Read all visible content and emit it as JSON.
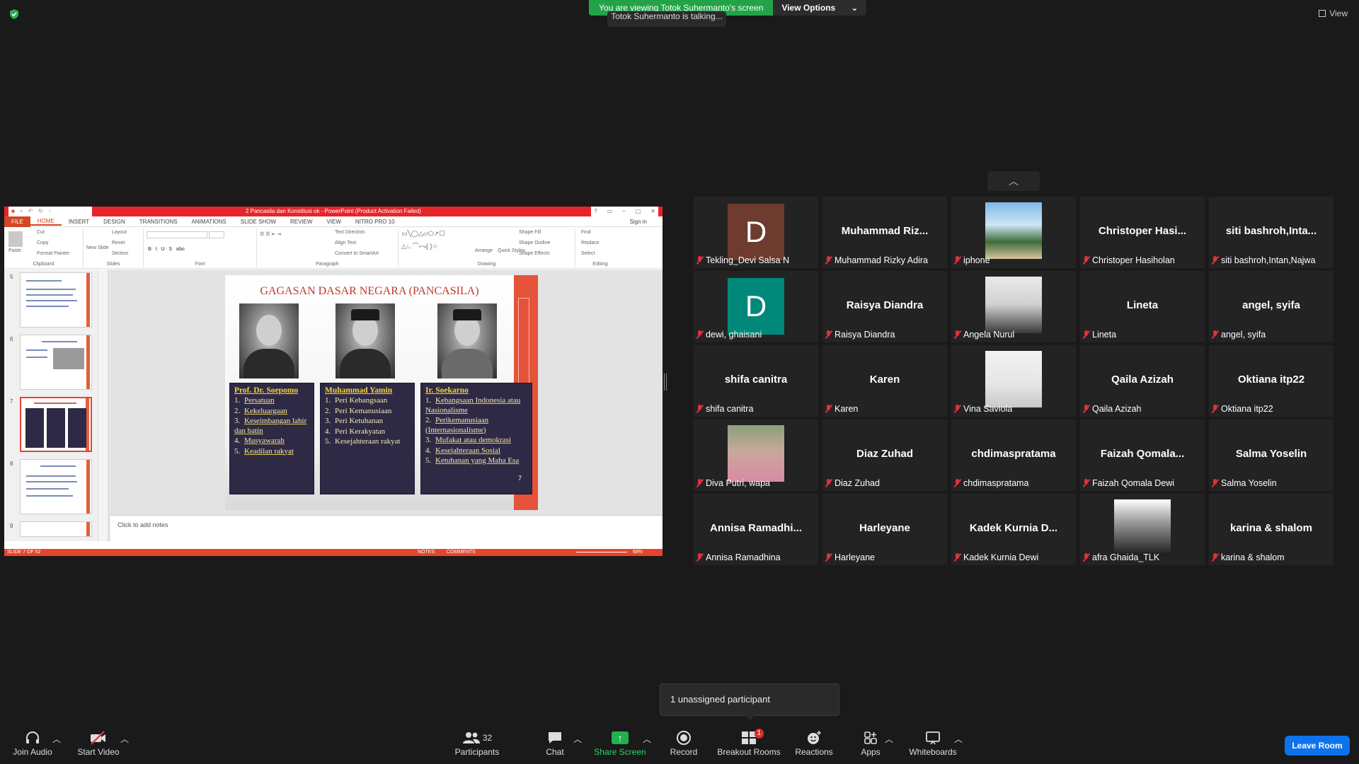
{
  "app": {
    "viewing_banner": "You are viewing Totok Suhermanto's screen",
    "view_options": "View Options",
    "talking": "Totok Suhermanto is talking...",
    "view_label": "View"
  },
  "ppt": {
    "window_title": "2 Pancasila dan Konstitusi ok - PowerPoint (Product Activation Failed)",
    "tabs": [
      "FILE",
      "HOME",
      "INSERT",
      "DESIGN",
      "TRANSITIONS",
      "ANIMATIONS",
      "SLIDE SHOW",
      "REVIEW",
      "VIEW",
      "NITRO PRO 10"
    ],
    "active_tab": "HOME",
    "sign_in": "Sign in",
    "groups": {
      "clipboard": "Clipboard",
      "slides": "Slides",
      "font": "Font",
      "paragraph": "Paragraph",
      "drawing": "Drawing",
      "editing": "Editing"
    },
    "clipboard_items": {
      "paste": "Paste",
      "cut": "Cut",
      "copy": "Copy",
      "format_painter": "Format Painter"
    },
    "slides_items": {
      "new_slide": "New Slide",
      "layout": "Layout",
      "reset": "Reset",
      "section": "Section"
    },
    "paragraph_items": {
      "text_direction": "Text Direction",
      "align_text": "Align Text",
      "smartart": "Convert to SmartArt"
    },
    "drawing_items": {
      "arrange": "Arrange",
      "quick_styles": "Quick Styles",
      "shape_fill": "Shape Fill",
      "shape_outline": "Shape Outline",
      "shape_effects": "Shape Effects"
    },
    "editing_items": {
      "find": "Find",
      "replace": "Replace",
      "select": "Select"
    },
    "thumb_numbers": [
      "5",
      "6",
      "7",
      "8",
      "9"
    ],
    "selected_slide": "7",
    "slide": {
      "title": "GAGASAN DASAR NEGARA (PANCASILA)",
      "page_number": "7",
      "columns": [
        {
          "heading": "Prof. Dr. Soepomo",
          "items": [
            "Persatuan",
            "Kekeluargaan",
            "Keseimbangan lahir dan batin",
            "Musyawarah",
            "Keadilan rakyat"
          ]
        },
        {
          "heading": "Muhammad Yamin",
          "items": [
            "Peri Kebangsaan",
            "Peri Kemanusiaan",
            "Peri Ketuhanan",
            "Peri Kerakyatan",
            "Kesejahteraan rakyat"
          ]
        },
        {
          "heading": "Ir. Soekarno",
          "items": [
            "Kebangsaan Indonesia atau Nasionalisme",
            "Perikemanusiaan (Internasionalisme)",
            "Mufakat atau demokrasi",
            "Kesejahteraan Sosial",
            "Ketuhanan yang Maha Esa"
          ]
        }
      ]
    },
    "notes_placeholder": "Click to add notes",
    "status": {
      "slide_counter": "SLIDE 7 OF 52",
      "notes": "NOTES",
      "comments": "COMMENTS",
      "zoom": "68%"
    }
  },
  "participants": [
    {
      "display": "avatar",
      "letter": "D",
      "color": "#6e3b2f",
      "name": "Tekling_Devi Salsa N"
    },
    {
      "display": "text",
      "big": "Muhammad  Riz...",
      "name": "Muhammad Rizky Adira"
    },
    {
      "display": "photo",
      "name": "iphone"
    },
    {
      "display": "text",
      "big": "Christoper  Hasi...",
      "name": "Christoper Hasiholan"
    },
    {
      "display": "text",
      "big": "siti  bashroh,Inta...",
      "name": "siti bashroh,Intan,Najwa"
    },
    {
      "display": "avatar",
      "letter": "D",
      "color": "#00897b",
      "name": "dewi, ghaisani"
    },
    {
      "display": "text",
      "big": "Raisya Diandra",
      "name": "Raisya Diandra"
    },
    {
      "display": "photo",
      "name": "Angela Nurul"
    },
    {
      "display": "text",
      "big": "Lineta",
      "name": "Lineta"
    },
    {
      "display": "text",
      "big": "angel, syifa",
      "name": "angel, syifa"
    },
    {
      "display": "text",
      "big": "shifa canitra",
      "name": "shifa canitra"
    },
    {
      "display": "text",
      "big": "Karen",
      "name": "Karen"
    },
    {
      "display": "photo",
      "name": "Vina Saviola"
    },
    {
      "display": "text",
      "big": "Qaila Azizah",
      "name": "Qaila Azizah"
    },
    {
      "display": "text",
      "big": "Oktiana itp22",
      "name": "Oktiana itp22"
    },
    {
      "display": "photo",
      "name": "Diva Putri, wapa"
    },
    {
      "display": "text",
      "big": "Diaz Zuhad",
      "name": "Diaz Zuhad"
    },
    {
      "display": "text",
      "big": "chdimaspratama",
      "name": "chdimaspratama"
    },
    {
      "display": "text",
      "big": "Faizah  Qomala...",
      "name": "Faizah Qomala Dewi"
    },
    {
      "display": "text",
      "big": "Salma Yoselin",
      "name": "Salma Yoselin"
    },
    {
      "display": "text",
      "big": "Annisa  Ramadhi...",
      "name": "Annisa Ramadhina"
    },
    {
      "display": "text",
      "big": "Harleyane",
      "name": "Harleyane"
    },
    {
      "display": "text",
      "big": "Kadek  Kurnia  D...",
      "name": "Kadek Kurnia Dewi"
    },
    {
      "display": "photo",
      "name": "afra Ghaida_TLK"
    },
    {
      "display": "text",
      "big": "karina & shalom",
      "name": "karina & shalom"
    }
  ],
  "toast": "1 unassigned participant",
  "toolbar": {
    "join_audio": "Join Audio",
    "start_video": "Start Video",
    "participants": "Participants",
    "participant_count": "32",
    "chat": "Chat",
    "share_screen": "Share Screen",
    "record": "Record",
    "breakout_rooms": "Breakout Rooms",
    "breakout_badge": "1",
    "reactions": "Reactions",
    "apps": "Apps",
    "whiteboards": "Whiteboards",
    "leave_room": "Leave Room"
  },
  "colors": {
    "accent_green": "#23a347",
    "ppt_red": "#e6252b",
    "leave_blue": "#0e72ed",
    "muted_red": "#e0313b"
  }
}
